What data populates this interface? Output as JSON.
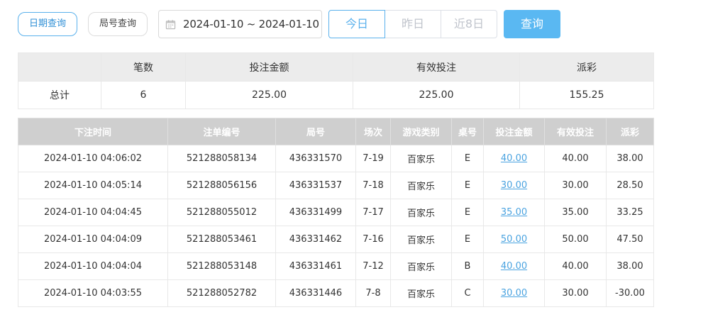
{
  "filters": {
    "date_query": "日期查询",
    "round_query": "局号查询",
    "date_range": "2024-01-10 ~ 2024-01-10",
    "quick_ranges": [
      "今日",
      "昨日",
      "近8日"
    ],
    "query": "查询"
  },
  "summary": {
    "headers": [
      "",
      "笔数",
      "投注金额",
      "有效投注",
      "派彩"
    ],
    "row": [
      "总计",
      "6",
      "225.00",
      "225.00",
      "155.25"
    ]
  },
  "detail": {
    "headers": [
      "下注时间",
      "注单编号",
      "局号",
      "场次",
      "游戏类别",
      "桌号",
      "投注金额",
      "有效投注",
      "派彩"
    ],
    "rows": [
      [
        "2024-01-10 04:06:02",
        "521288058134",
        "436331570",
        "7-19",
        "百家乐",
        "E",
        "40.00",
        "40.00",
        "38.00"
      ],
      [
        "2024-01-10 04:05:14",
        "521288056156",
        "436331537",
        "7-18",
        "百家乐",
        "E",
        "30.00",
        "30.00",
        "28.50"
      ],
      [
        "2024-01-10 04:04:45",
        "521288055012",
        "436331499",
        "7-17",
        "百家乐",
        "E",
        "35.00",
        "35.00",
        "33.25"
      ],
      [
        "2024-01-10 04:04:09",
        "521288053461",
        "436331462",
        "7-16",
        "百家乐",
        "E",
        "50.00",
        "50.00",
        "47.50"
      ],
      [
        "2024-01-10 04:04:04",
        "521288053148",
        "436331461",
        "7-12",
        "百家乐",
        "B",
        "40.00",
        "40.00",
        "38.00"
      ],
      [
        "2024-01-10 04:03:55",
        "521288052782",
        "436331446",
        "7-8",
        "百家乐",
        "C",
        "30.00",
        "30.00",
        "-30.00"
      ]
    ]
  },
  "colors": {
    "accent": "#5ab1ec",
    "query_button": "#5ab8f2",
    "link": "#4aa3e0",
    "negative": "#e0414b",
    "detail_header_bg": "#cfcfcf",
    "summary_header_bg": "#ececec"
  },
  "icons": {
    "range": "calendar-icon"
  }
}
